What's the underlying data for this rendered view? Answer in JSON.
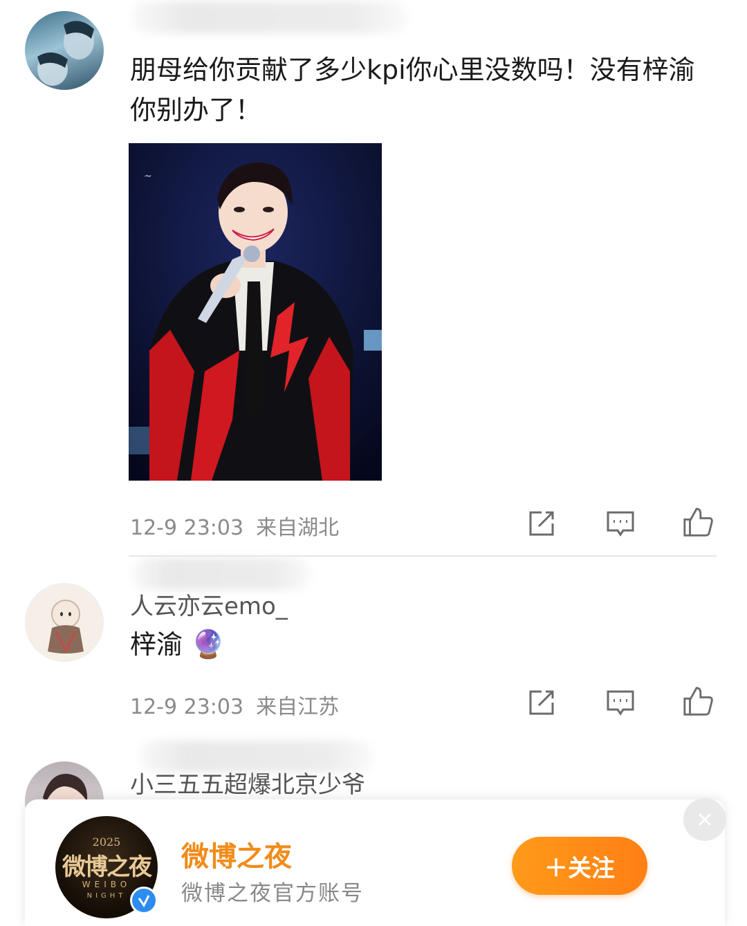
{
  "comments": [
    {
      "username": "",
      "text": "朋母给你贡献了多少kpi你心里没数吗！没有梓渝你别办了！",
      "time": "12-9 23:03",
      "location": "来自湖北"
    },
    {
      "username": "人云亦云emo_",
      "text": "梓渝",
      "emoji": "🔮",
      "time": "12-9 23:03",
      "location": "来自江苏"
    },
    {
      "username": "小三五五超爆北京少爷"
    }
  ],
  "promo": {
    "name": "微博之夜",
    "description": "微博之夜官方账号",
    "follow_label": "＋关注",
    "logo": {
      "year": "2025",
      "title": "微博之夜",
      "subtitle_1": "WEIBO",
      "subtitle_2": "NIGHT"
    }
  },
  "colors": {
    "accent_orange": "#ff8a17",
    "brand_name": "#f08c1a",
    "verified_blue": "#2d8cf0",
    "meta_gray": "#8a8a8a"
  },
  "icons": [
    "share-icon",
    "comment-icon",
    "like-icon",
    "verified-icon",
    "close-icon"
  ]
}
